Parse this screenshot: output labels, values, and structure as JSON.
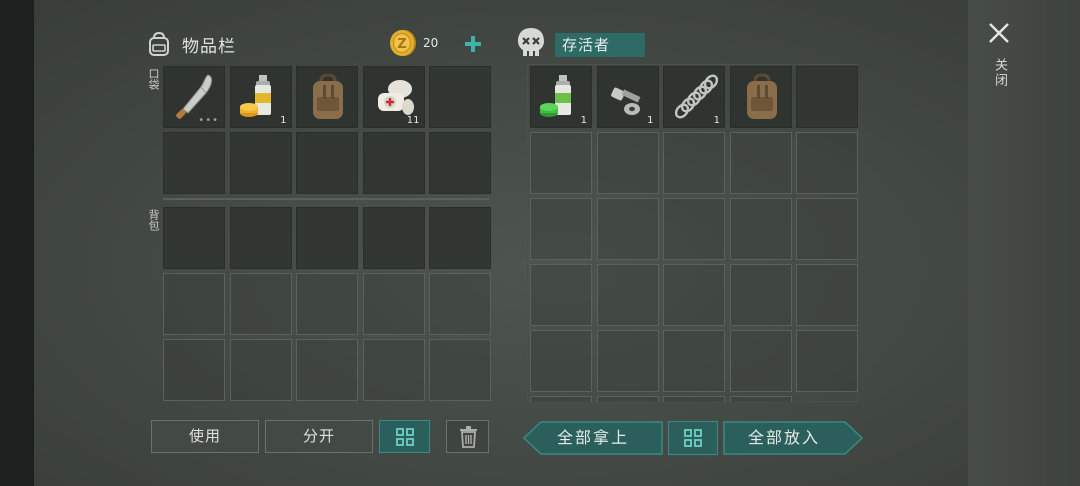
{
  "inventory": {
    "title": "物品栏",
    "coins": "20",
    "pocket_label": "口袋",
    "backpack_label": "背包",
    "pocket_items": [
      {
        "icon": "machete-icon",
        "count": ""
      },
      {
        "icon": "spray-paint-yellow-icon",
        "count": "1"
      },
      {
        "icon": "backpack-icon",
        "count": ""
      },
      {
        "icon": "bandage-icon",
        "count": "11"
      }
    ]
  },
  "container": {
    "title": "存活者",
    "items": [
      {
        "icon": "spray-paint-green-icon",
        "count": "1"
      },
      {
        "icon": "bolt-nut-icon",
        "count": "1"
      },
      {
        "icon": "spring-icon",
        "count": "1"
      },
      {
        "icon": "backpack-icon",
        "count": ""
      }
    ]
  },
  "buttons": {
    "use": "使用",
    "split": "分开",
    "take_all": "全部拿上",
    "put_all": "全部放入"
  },
  "close": {
    "label": "关闭"
  },
  "colors": {
    "accent": "#2b5f5b",
    "accent_border": "#3a8a83",
    "coin": "#e3b02e"
  }
}
